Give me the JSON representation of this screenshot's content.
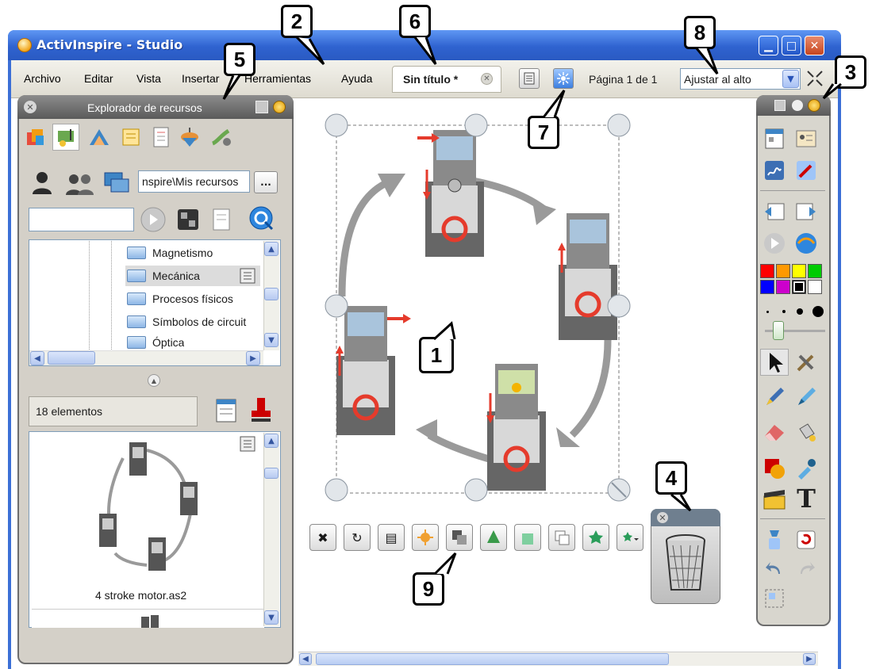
{
  "window": {
    "title": "ActivInspire - Studio"
  },
  "menu": [
    "Archivo",
    "Editar",
    "Vista",
    "Insertar",
    "Herramientas",
    "Ayuda"
  ],
  "document_tab": {
    "label": "Sin título *"
  },
  "page_indicator": "Página 1 de 1",
  "zoom": {
    "selected": "Ajustar al alto"
  },
  "explorer": {
    "title": "Explorador de recursos",
    "path": "nspire\\Mis recursos",
    "browse_label": "...",
    "folders": [
      "Magnetismo",
      "Mecánica",
      "Procesos físicos",
      "Símbolos de circuit",
      "Óptica"
    ],
    "selected_folder": "Mecánica",
    "item_count": "18 elementos",
    "preview_file": "4 stroke motor.as2"
  },
  "callouts": [
    "1",
    "2",
    "3",
    "4",
    "5",
    "6",
    "7",
    "8",
    "9"
  ],
  "palette_colors": [
    "#ff0000",
    "#ff9900",
    "#ffff00",
    "#00cc00",
    "#0000ff",
    "#cc00cc",
    "#000000",
    "#ffffff"
  ],
  "accent_colors": {
    "titlebar": "#2f63d0",
    "panel_header": "#5a5a5a",
    "arrow": "#9a9a9a",
    "piston_marker": "#e53b2c"
  }
}
